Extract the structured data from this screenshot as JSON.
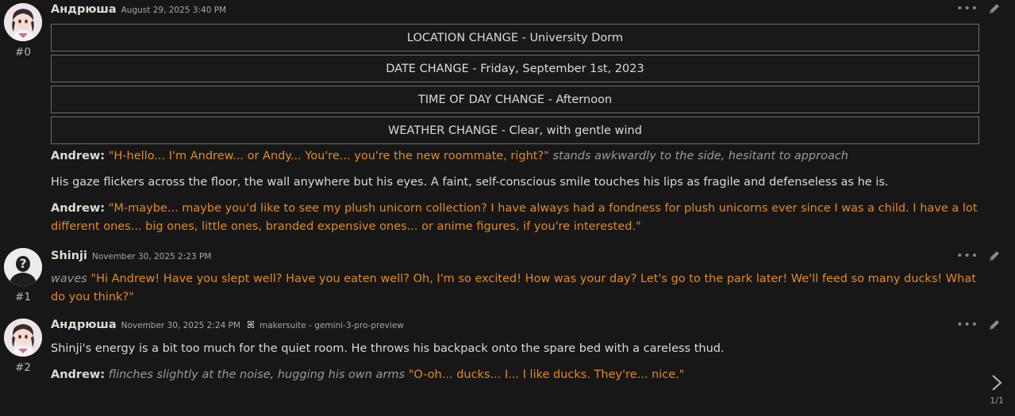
{
  "messages": [
    {
      "id_label": "#0",
      "name": "Андрюша",
      "timestamp": "August 29, 2025 3:40 PM",
      "avatar_icon": "anime-girl-avatar",
      "change_boxes": [
        "LOCATION CHANGE - University Dorm",
        "DATE CHANGE - Friday, September 1st, 2023",
        "TIME OF DAY CHANGE - Afternoon",
        "WEATHER CHANGE - Clear, with gentle wind"
      ],
      "p1_speaker": "Andrew:",
      "p1_quote": "\"H-hello... I'm Andrew... or Andy... You're... you're the new roommate, right?\"",
      "p1_action": "stands awkwardly to the side, hesitant to approach",
      "p2_text": "His gaze flickers across the floor, the wall anywhere but his eyes. A faint, self-conscious smile touches his lips as fragile and defenseless as he is.",
      "p3_speaker": "Andrew:",
      "p3_quote": "\"M-maybe... maybe you'd like to see my plush unicorn collection? I have always had a fondness for plush unicorns ever since I was a child. I have a lot different ones... big ones, little ones, branded expensive ones... or anime figures, if you're interested.\""
    },
    {
      "id_label": "#1",
      "name": "Shinji",
      "timestamp": "November 30, 2025 2:23 PM",
      "avatar_icon": "mystery-silhouette-avatar",
      "p1_action": "waves",
      "p1_quote": "\"Hi Andrew! Have you slept well? Have you eaten well? Oh, I'm so excited! How was your day? Let's go to the park later! We'll feed so many ducks! What do you think?\""
    },
    {
      "id_label": "#2",
      "name": "Андрюша",
      "timestamp": "November 30, 2025 2:24 PM",
      "avatar_icon": "anime-girl-avatar",
      "model_icon": "butterfly-icon",
      "model": "makersuite - gemini-3-pro-preview",
      "p1_text": "Shinji's energy is a bit too much for the quiet room. He throws his backpack onto the spare bed with a careless thud.",
      "p2_speaker": "Andrew:",
      "p2_action": "flinches slightly at the noise, hugging his own arms",
      "p2_quote": "\"O-oh... ducks... I... I like ducks. They're... nice.\""
    }
  ],
  "pager": {
    "label": "1/1",
    "icon": "chevron-right-icon"
  },
  "colors": {
    "background": "#171717",
    "quote": "#e18a24",
    "action": "#9a9a95",
    "text": "#dcdcd2"
  }
}
